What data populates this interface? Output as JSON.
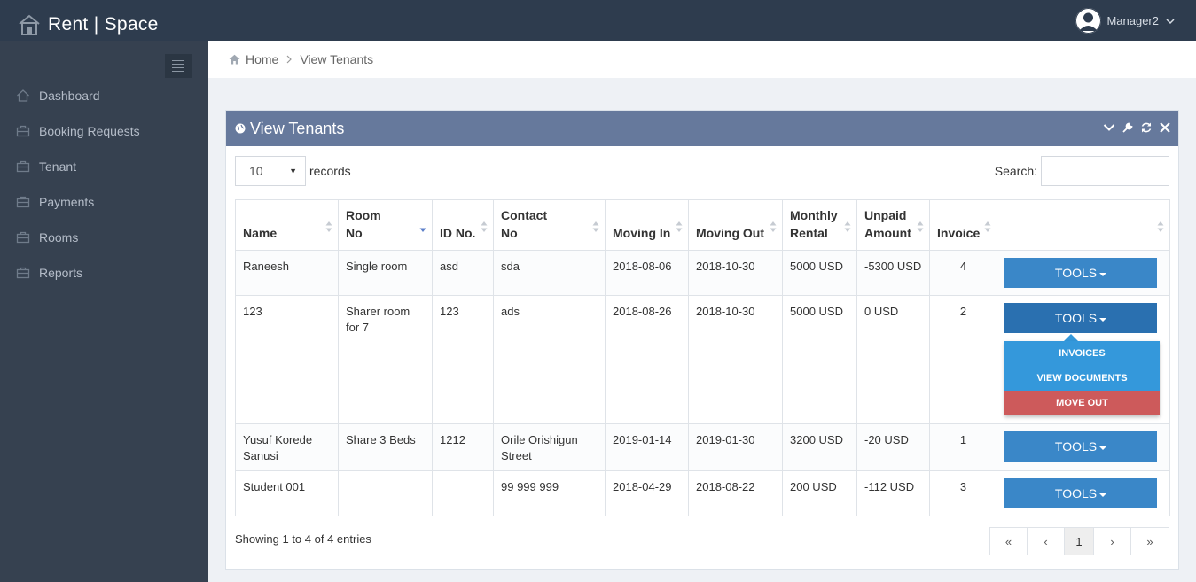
{
  "brand": {
    "title": "Rent | Space"
  },
  "user": {
    "name": "Manager2"
  },
  "sidebar": {
    "items": [
      {
        "label": "Dashboard",
        "icon": "home-icon"
      },
      {
        "label": "Booking Requests",
        "icon": "briefcase-icon"
      },
      {
        "label": "Tenant",
        "icon": "briefcase-icon"
      },
      {
        "label": "Payments",
        "icon": "briefcase-icon"
      },
      {
        "label": "Rooms",
        "icon": "briefcase-icon"
      },
      {
        "label": "Reports",
        "icon": "briefcase-icon"
      }
    ]
  },
  "breadcrumb": {
    "home": "Home",
    "current": "View Tenants"
  },
  "portlet": {
    "title": "View Tenants"
  },
  "table_controls": {
    "length_value": "10",
    "length_label": "records",
    "search_label": "Search:",
    "search_value": ""
  },
  "table": {
    "headers": [
      {
        "line1": "Name",
        "line2": ""
      },
      {
        "line1": "Room",
        "line2": "No"
      },
      {
        "line1": "ID No.",
        "line2": ""
      },
      {
        "line1": "Contact",
        "line2": "No"
      },
      {
        "line1": "Moving In",
        "line2": ""
      },
      {
        "line1": "Moving Out",
        "line2": ""
      },
      {
        "line1": "Monthly",
        "line2": "Rental"
      },
      {
        "line1": "Unpaid",
        "line2": "Amount"
      },
      {
        "line1": "Invoice",
        "line2": ""
      },
      {
        "line1": "",
        "line2": ""
      }
    ],
    "rows": [
      {
        "name": "Raneesh",
        "room": "Single room",
        "id": "asd",
        "contact": "sda",
        "in": "2018-08-06",
        "out": "2018-10-30",
        "rental": "5000 USD",
        "unpaid": "-5300 USD",
        "invoice": "4",
        "tools": "TOOLS"
      },
      {
        "name": "123",
        "room": "Sharer room for 7",
        "id": "123",
        "contact": "ads",
        "in": "2018-08-26",
        "out": "2018-10-30",
        "rental": "5000 USD",
        "unpaid": "0 USD",
        "invoice": "2",
        "tools": "TOOLS"
      },
      {
        "name": "Yusuf Korede Sanusi",
        "room": "Share 3 Beds",
        "id": "1212",
        "contact": "Orile Orishigun Street",
        "in": "2019-01-14",
        "out": "2019-01-30",
        "rental": "3200 USD",
        "unpaid": "-20 USD",
        "invoice": "1",
        "tools": "TOOLS"
      },
      {
        "name": "Student 001",
        "room": "",
        "id": "",
        "contact": "99 999 999",
        "in": "2018-04-29",
        "out": "2018-08-22",
        "rental": "200 USD",
        "unpaid": "-112 USD",
        "invoice": "3",
        "tools": "TOOLS"
      }
    ]
  },
  "dropdown": {
    "items": [
      "INVOICES",
      "VIEW DOCUMENTS",
      "MOVE OUT"
    ]
  },
  "footer": {
    "info": "Showing 1 to 4 of 4 entries",
    "pager": {
      "first": "«",
      "prev": "‹",
      "page": "1",
      "next": "›",
      "last": "»"
    }
  },
  "colors": {
    "topbar": "#2e3c4e",
    "sidebar": "#364150",
    "portlet_header": "#66799c",
    "button": "#3a87c8",
    "danger": "#cd5a5b"
  }
}
